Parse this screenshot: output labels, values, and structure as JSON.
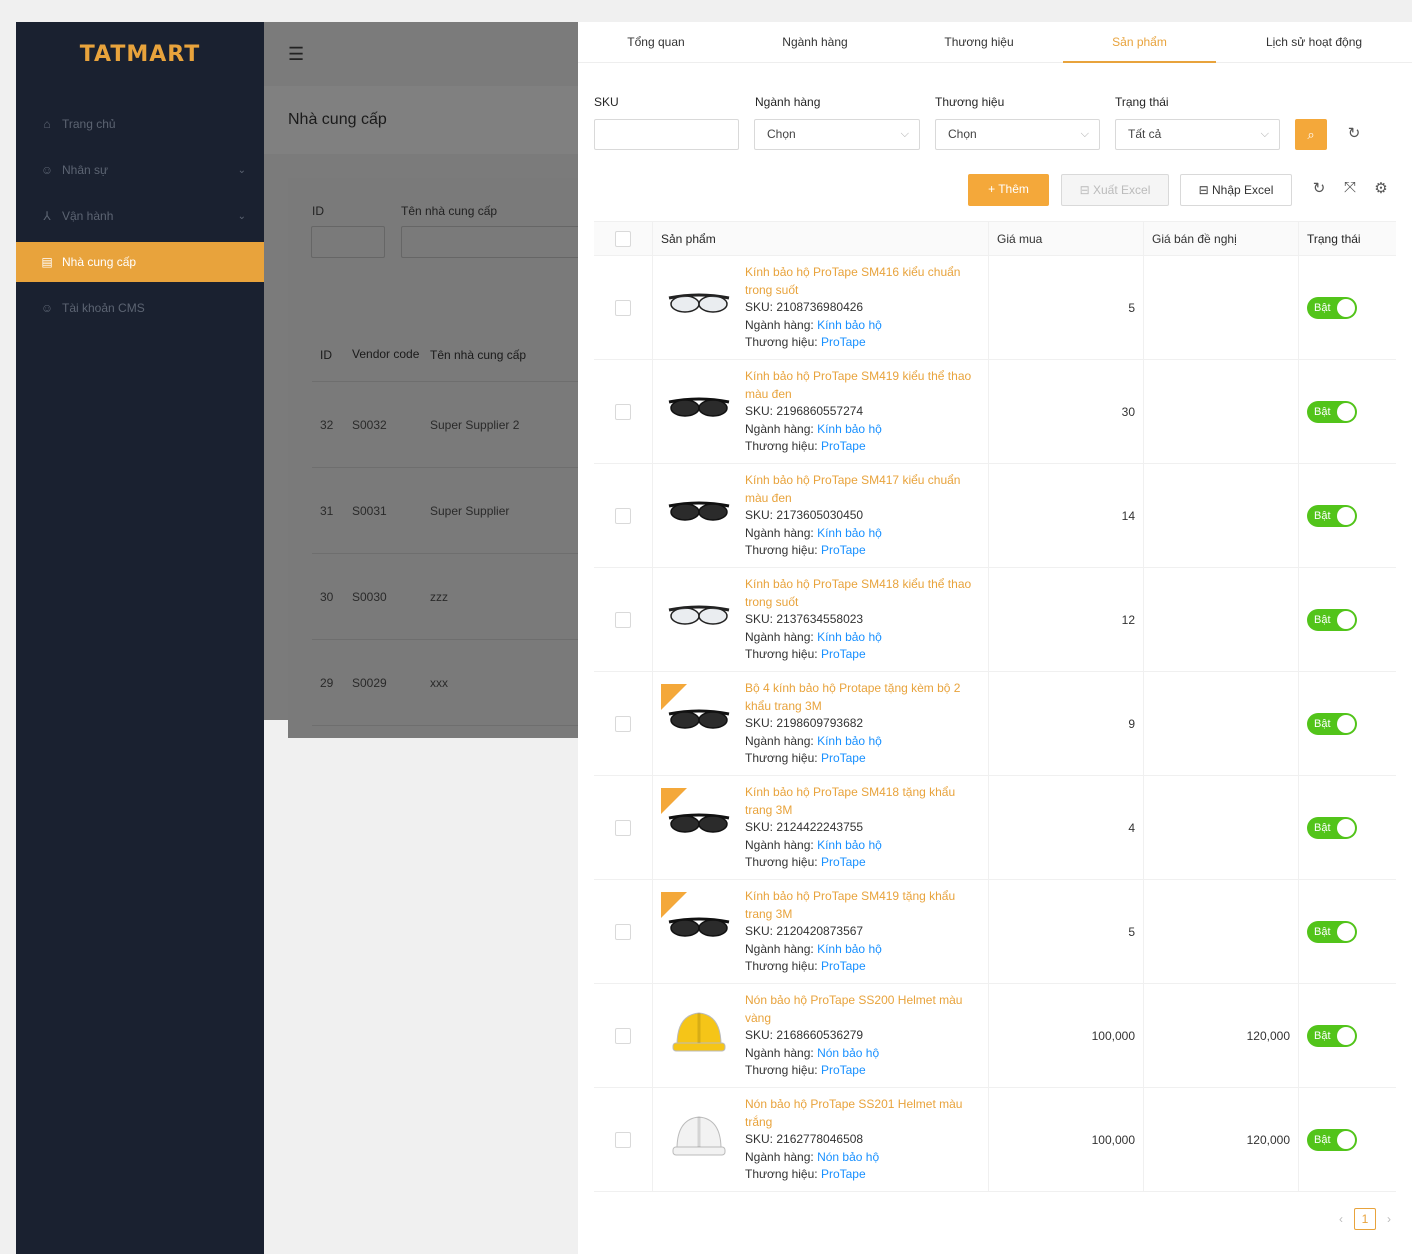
{
  "sidebar": {
    "logo": "TATMART",
    "items": [
      {
        "label": "Trang chủ",
        "icon": "home-icon"
      },
      {
        "label": "Nhân sự",
        "icon": "user-group-icon"
      },
      {
        "label": "Vận hành",
        "icon": "operation-icon"
      },
      {
        "label": "Nhà cung cấp",
        "icon": "supplier-icon",
        "active": true
      },
      {
        "label": "Tài khoản CMS",
        "icon": "account-icon"
      }
    ]
  },
  "background_page": {
    "title": "Nhà cung cấp",
    "filter_labels": {
      "id": "ID",
      "name": "Tên nhà cung cấp"
    },
    "table": {
      "headers": {
        "id": "ID",
        "vendor_code": "Vendor code",
        "name": "Tên nhà cung cấp"
      },
      "rows": [
        {
          "id": "32",
          "code": "S0032",
          "name": "Super Supplier 2"
        },
        {
          "id": "31",
          "code": "S0031",
          "name": "Super Supplier"
        },
        {
          "id": "30",
          "code": "S0030",
          "name": "zzz"
        },
        {
          "id": "29",
          "code": "S0029",
          "name": "xxx"
        }
      ]
    }
  },
  "drawer": {
    "tabs": [
      "Tổng quan",
      "Ngành hàng",
      "Thương hiệu",
      "Sản phẩm",
      "Lịch sử hoạt động"
    ],
    "active_tab": "Sản phẩm",
    "filters": {
      "sku_label": "SKU",
      "category_label": "Ngành hàng",
      "category_value": "Chọn",
      "brand_label": "Thương hiệu",
      "brand_value": "Chọn",
      "status_label": "Trạng thái",
      "status_value": "Tất cả"
    },
    "actions": {
      "add": "+ Thêm",
      "export": "Xuất Excel",
      "import": "Nhập Excel"
    },
    "table": {
      "headers": {
        "product": "Sản phẩm",
        "buy_price": "Giá mua",
        "suggest_price": "Giá bán đề nghị",
        "status": "Trạng thái"
      },
      "sku_prefix": "SKU: ",
      "category_prefix": "Ngành hàng: ",
      "brand_prefix": "Thương hiệu: ",
      "toggle_label": "Bật",
      "rows": [
        {
          "name": "Kính bảo hộ ProTape SM416 kiểu chuẩn trong suốt",
          "sku": "2108736980426",
          "category": "Kính bảo hộ",
          "brand": "ProTape",
          "buy": "5",
          "suggest": "",
          "thumb": "clear-glasses"
        },
        {
          "name": "Kính bảo hộ ProTape SM419 kiểu thể thao màu đen",
          "sku": "2196860557274",
          "category": "Kính bảo hộ",
          "brand": "ProTape",
          "buy": "30",
          "suggest": "",
          "thumb": "dark-glasses"
        },
        {
          "name": "Kính bảo hộ ProTape SM417 kiểu chuẩn màu đen",
          "sku": "2173605030450",
          "category": "Kính bảo hộ",
          "brand": "ProTape",
          "buy": "14",
          "suggest": "",
          "thumb": "dark-glasses"
        },
        {
          "name": "Kính bảo hộ ProTape SM418 kiểu thể thao trong suốt",
          "sku": "2137634558023",
          "category": "Kính bảo hộ",
          "brand": "ProTape",
          "buy": "12",
          "suggest": "",
          "thumb": "clear-glasses"
        },
        {
          "name": "Bộ 4 kính bảo hộ Protape tặng kèm bộ 2 khẩu trang 3M",
          "sku": "2198609793682",
          "category": "Kính bảo hộ",
          "brand": "ProTape",
          "buy": "9",
          "suggest": "",
          "thumb": "promo"
        },
        {
          "name": "Kính bảo hộ ProTape SM418 tặng khẩu trang 3M",
          "sku": "2124422243755",
          "category": "Kính bảo hộ",
          "brand": "ProTape",
          "buy": "4",
          "suggest": "",
          "thumb": "promo"
        },
        {
          "name": "Kính bảo hộ ProTape SM419 tặng khẩu trang 3M",
          "sku": "2120420873567",
          "category": "Kính bảo hộ",
          "brand": "ProTape",
          "buy": "5",
          "suggest": "",
          "thumb": "promo"
        },
        {
          "name": "Nón bảo hộ ProTape SS200 Helmet màu vàng",
          "sku": "2168660536279",
          "category": "Nón bảo hộ",
          "brand": "ProTape",
          "buy": "100,000",
          "suggest": "120,000",
          "thumb": "yellow-helmet"
        },
        {
          "name": "Nón bảo hộ ProTape SS201 Helmet màu trắng",
          "sku": "2162778046508",
          "category": "Nón bảo hộ",
          "brand": "ProTape",
          "buy": "100,000",
          "suggest": "120,000",
          "thumb": "white-helmet"
        }
      ]
    },
    "pagination": {
      "current": "1"
    }
  },
  "colors": {
    "accent": "#e8a33c",
    "link": "#1890ff",
    "toggle_on": "#52c41a",
    "sidebar_bg": "#1a2130"
  }
}
